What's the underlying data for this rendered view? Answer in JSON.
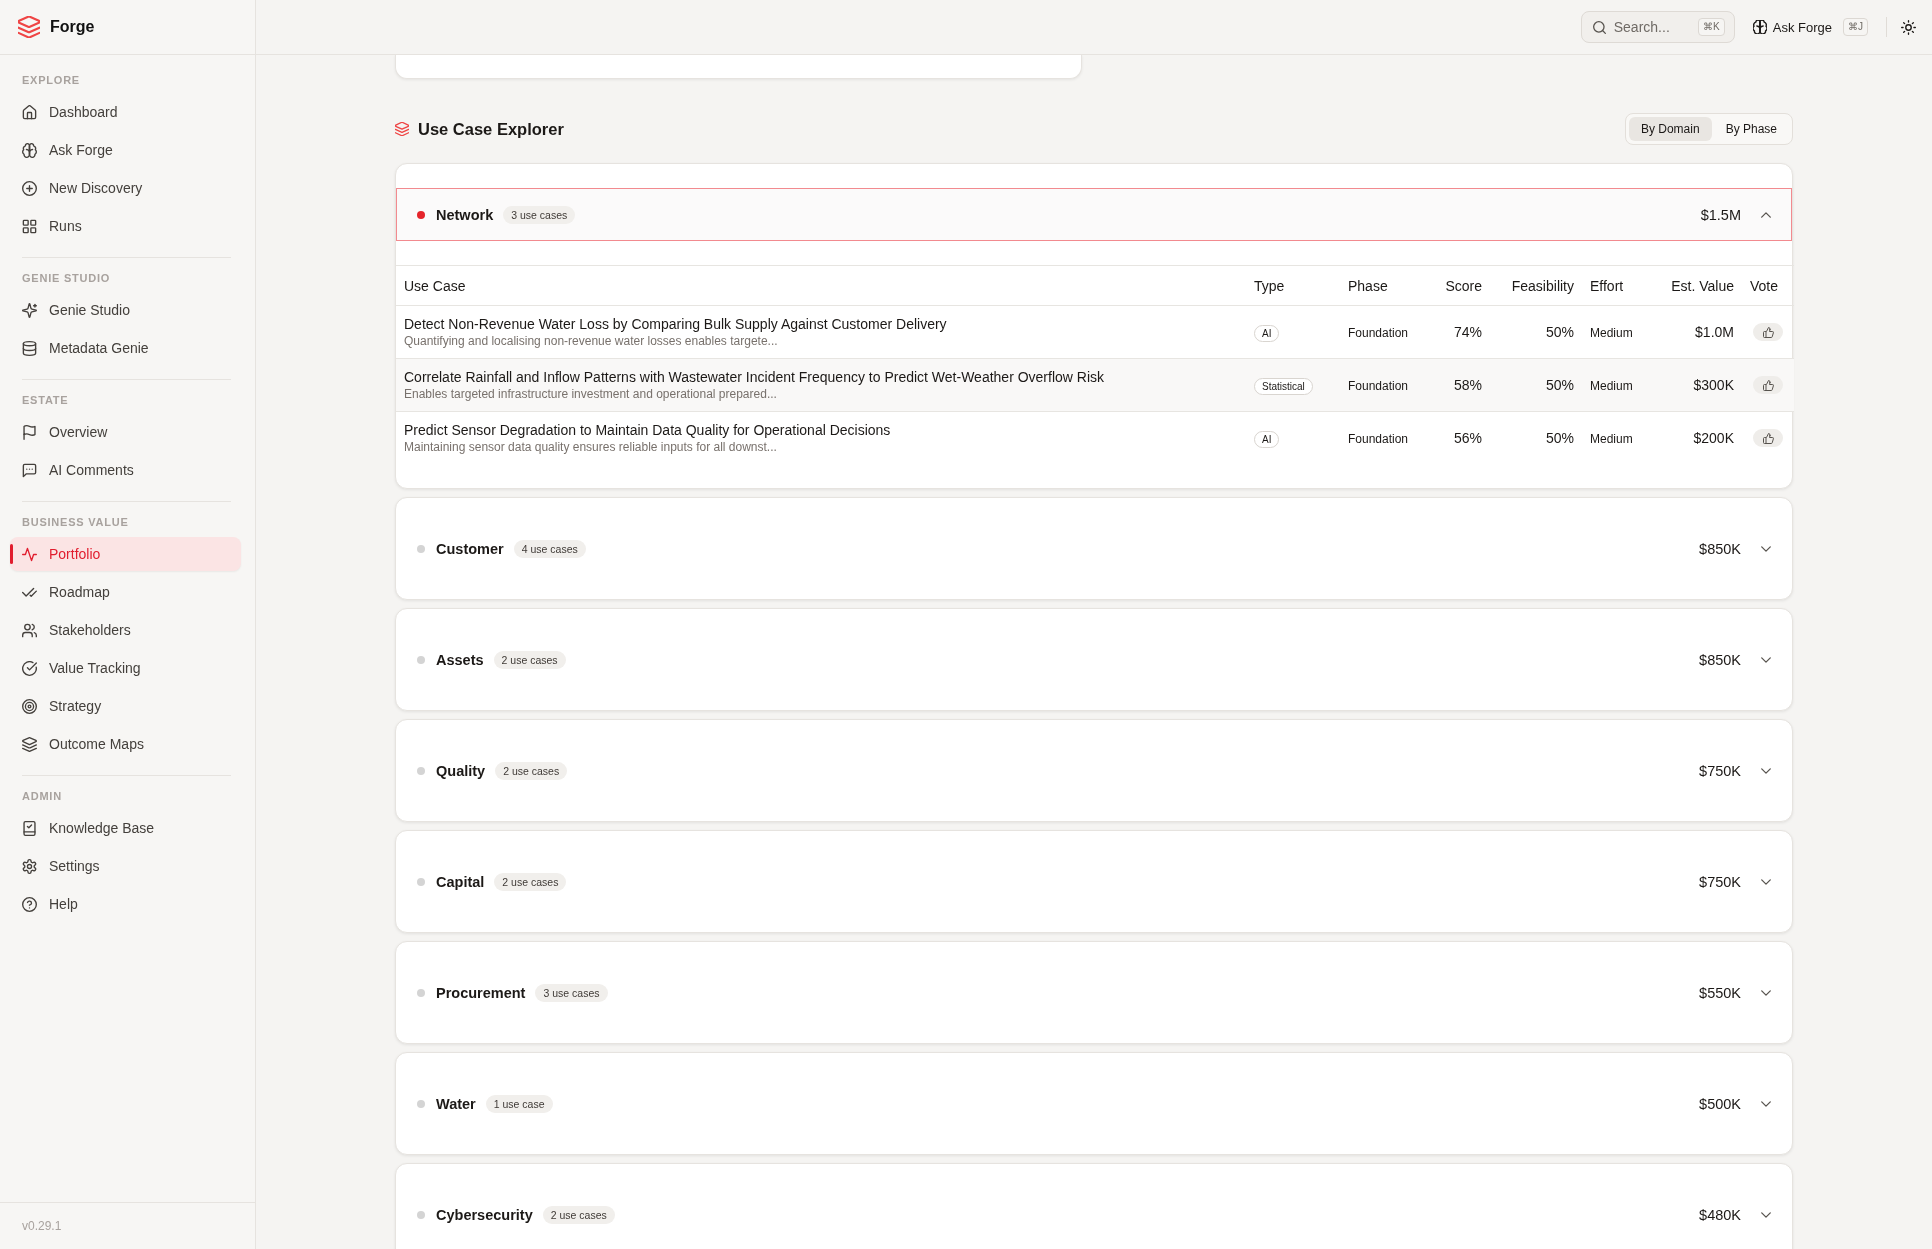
{
  "sidebar": {
    "logo": {
      "name": "Forge"
    },
    "sections": [
      {
        "title": "EXPLORE",
        "items": [
          {
            "label": "Dashboard",
            "selected": false
          },
          {
            "label": "Ask Forge",
            "selected": false
          },
          {
            "label": "New Discovery",
            "selected": false
          },
          {
            "label": "Runs",
            "selected": false
          }
        ]
      },
      {
        "title": "GENIE STUDIO",
        "items": [
          {
            "label": "Genie Studio",
            "selected": false
          },
          {
            "label": "Metadata Genie",
            "selected": false
          }
        ]
      },
      {
        "title": "ESTATE",
        "items": [
          {
            "label": "Overview",
            "selected": false
          },
          {
            "label": "AI Comments",
            "selected": false
          }
        ]
      },
      {
        "title": "BUSINESS VALUE",
        "items": [
          {
            "label": "Portfolio",
            "selected": true
          },
          {
            "label": "Roadmap",
            "selected": false
          },
          {
            "label": "Stakeholders",
            "selected": false
          },
          {
            "label": "Value Tracking",
            "selected": false
          },
          {
            "label": "Strategy",
            "selected": false
          },
          {
            "label": "Outcome Maps",
            "selected": false
          }
        ]
      },
      {
        "title": "ADMIN",
        "items": [
          {
            "label": "Knowledge Base",
            "selected": false
          },
          {
            "label": "Settings",
            "selected": false
          },
          {
            "label": "Help",
            "selected": false
          }
        ]
      }
    ],
    "version": "v0.29.1"
  },
  "top_bar": {
    "search": {
      "placeholder": "Search...",
      "shortcut": "⌘K"
    },
    "ask_button": {
      "label": "Ask Forge",
      "shortcut": "⌘J"
    }
  },
  "use_case_explorer": {
    "title": "Use Case Explorer",
    "view_toggle": [
      {
        "label": "By Domain",
        "selected": true
      },
      {
        "label": "By Phase",
        "selected": false
      }
    ],
    "domains": [
      {
        "name": "Network",
        "count": "3 use cases",
        "value": "$1.5M",
        "color": "#e5252b",
        "expanded": true,
        "table": {
          "columns": [
            "Use Case",
            "Type",
            "Phase",
            "Score",
            "Feasibility",
            "Effort",
            "Est. Value",
            "Vote"
          ],
          "rows": [
            {
              "title": "Detect Non-Revenue Water Loss by Comparing Bulk Supply Against Customer Delivery",
              "description": "Quantifying and localising non-revenue water losses enables targete...",
              "type": "AI",
              "phase": "Foundation",
              "score": "74%",
              "feasibility": "50%",
              "effort": "Medium",
              "value": "$1.0M"
            },
            {
              "title": "Correlate Rainfall and Inflow Patterns with Wastewater Incident Frequency to Predict Wet-Weather Overflow Risk",
              "description": "Enables targeted infrastructure investment and operational prepared...",
              "type": "Statistical",
              "phase": "Foundation",
              "score": "58%",
              "feasibility": "50%",
              "effort": "Medium",
              "value": "$300K"
            },
            {
              "title": "Predict Sensor Degradation to Maintain Data Quality for Operational Decisions",
              "description": "Maintaining sensor data quality ensures reliable inputs for all downst...",
              "type": "AI",
              "phase": "Foundation",
              "score": "56%",
              "feasibility": "50%",
              "effort": "Medium",
              "value": "$200K"
            }
          ]
        }
      },
      {
        "name": "Customer",
        "count": "4 use cases",
        "value": "$850K",
        "color": "#d4d4d4",
        "expanded": false
      },
      {
        "name": "Assets",
        "count": "2 use cases",
        "value": "$850K",
        "color": "#d4d4d4",
        "expanded": false
      },
      {
        "name": "Quality",
        "count": "2 use cases",
        "value": "$750K",
        "color": "#d4d4d4",
        "expanded": false
      },
      {
        "name": "Capital",
        "count": "2 use cases",
        "value": "$750K",
        "color": "#d4d4d4",
        "expanded": false
      },
      {
        "name": "Procurement",
        "count": "3 use cases",
        "value": "$550K",
        "color": "#d4d4d4",
        "expanded": false
      },
      {
        "name": "Water",
        "count": "1 use case",
        "value": "$500K",
        "color": "#d4d4d4",
        "expanded": false
      },
      {
        "name": "Cybersecurity",
        "count": "2 use cases",
        "value": "$480K",
        "color": "#d4d4d4",
        "expanded": false
      }
    ]
  }
}
